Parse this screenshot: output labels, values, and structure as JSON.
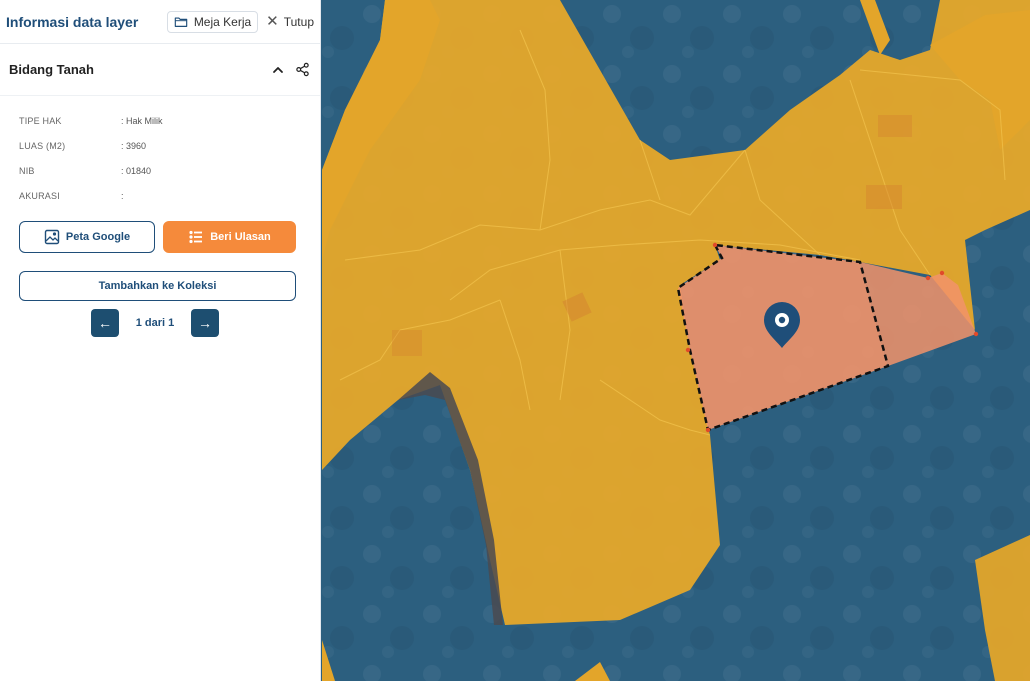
{
  "panel": {
    "title": "Informasi data layer",
    "workspace_label": "Meja Kerja",
    "close_label": "Tutup"
  },
  "section": {
    "title": "Bidang Tanah"
  },
  "attributes": [
    {
      "key": "TIPE HAK",
      "value": ": Hak Milik"
    },
    {
      "key": "LUAS (M2)",
      "value": ": 3960"
    },
    {
      "key": "NIB",
      "value": ": 01840"
    },
    {
      "key": "AKURASI",
      "value": ":"
    }
  ],
  "buttons": {
    "google_label": "Peta Google",
    "review_label": "Beri Ulasan",
    "collection_label": "Tambahkan ke Koleksi"
  },
  "pager": {
    "text": "1 dari 1",
    "prev_icon": "arrow-left-icon",
    "next_icon": "arrow-right-icon"
  },
  "colors": {
    "brand": "#1f4e79",
    "accent": "#f58a3b",
    "parcel": "#e6a82a",
    "water": "#2a5d7c",
    "selected": "#f2936a"
  }
}
